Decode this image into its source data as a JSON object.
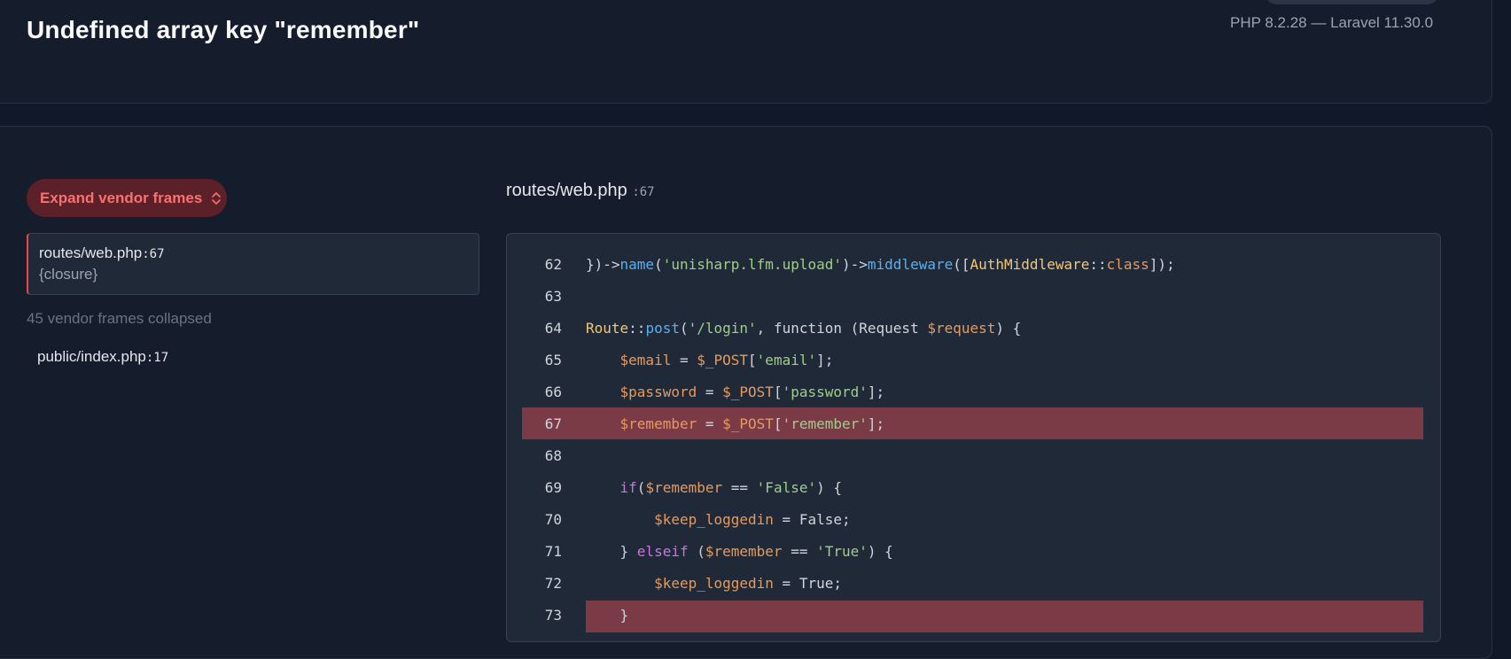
{
  "header": {
    "title": "Undefined array key \"remember\"",
    "version": "PHP 8.2.28 — Laravel 11.30.0"
  },
  "sidebar": {
    "expand_label": "Expand vendor frames",
    "active_frame": {
      "file": "routes/web.php",
      "line": ":67",
      "function": "{closure}"
    },
    "collapsed_text": "45 vendor frames collapsed",
    "frame2": {
      "file": "public/index.php",
      "line": ":17"
    }
  },
  "code": {
    "file": "routes/web.php",
    "line": ":67",
    "line_numbers": [
      "62",
      "63",
      "64",
      "65",
      "66",
      "67",
      "68",
      "69",
      "70",
      "71",
      "72",
      "73"
    ],
    "highlighted_line": "67",
    "lines": [
      "})->name('unisharp.lfm.upload')->middleware([AuthMiddleware::class]);",
      "",
      "Route::post('/login', function (Request $request) {",
      "    $email = $_POST['email'];",
      "    $password = $_POST['password'];",
      "    $remember = $_POST['remember'];",
      "",
      "    if($remember == 'False') {",
      "        $keep_loggedin = False;",
      "    } elseif ($remember == 'True') {",
      "        $keep_loggedin = True;",
      "    }"
    ]
  },
  "colors": {
    "accent_red": "#ef4444",
    "highlight_row": "#7b3b46",
    "background": "#111827"
  }
}
